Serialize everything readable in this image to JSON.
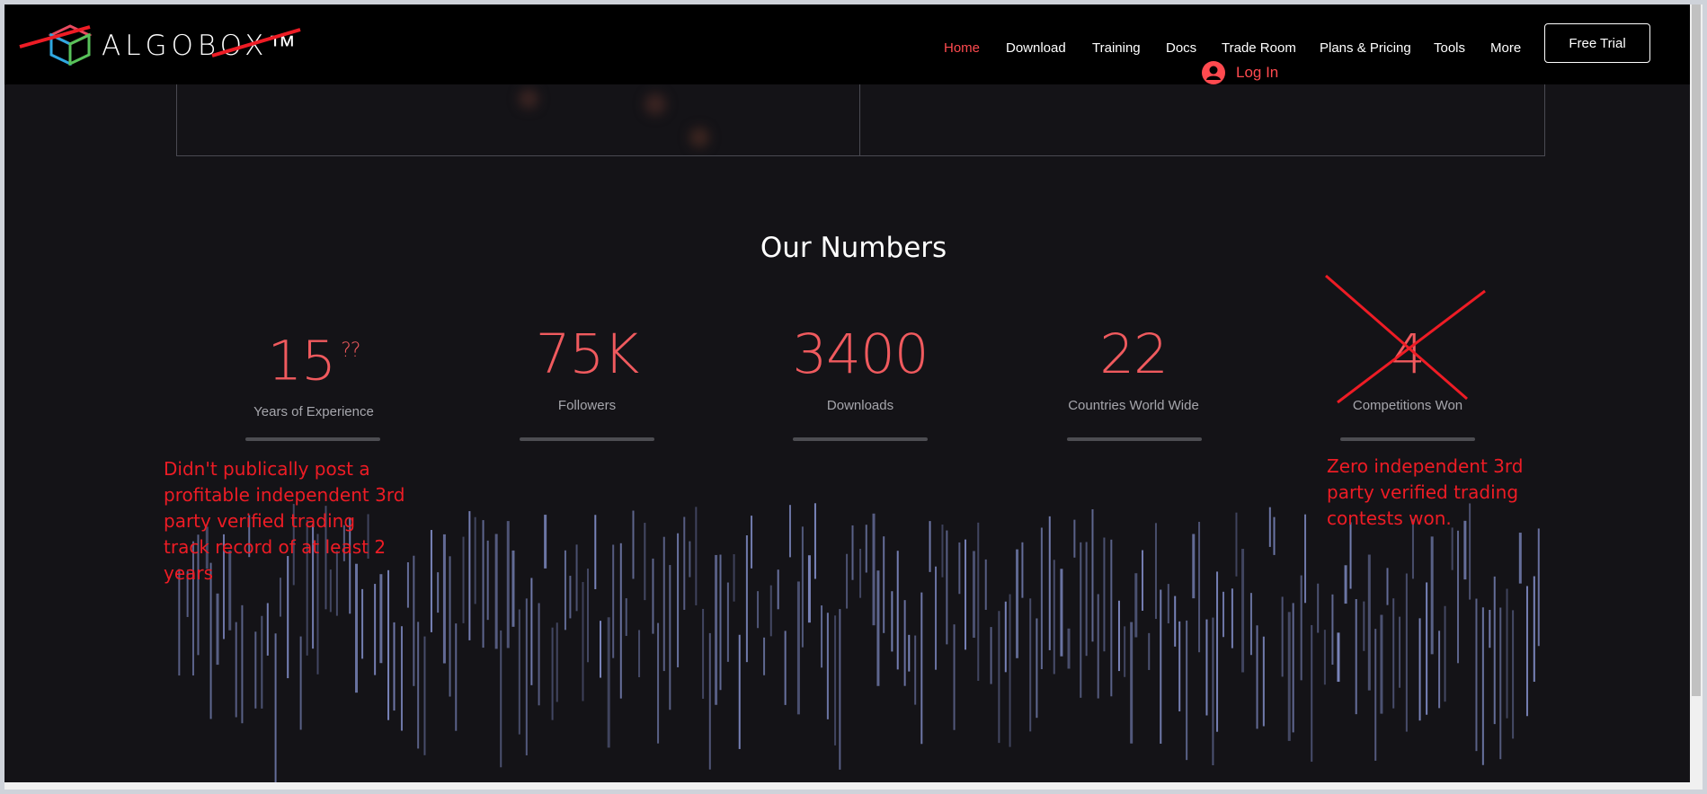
{
  "header": {
    "logo_text": "ALGOBOX™",
    "nav": [
      {
        "label": "Home",
        "active": true
      },
      {
        "label": "Download"
      },
      {
        "label": "Training"
      },
      {
        "label": "Docs"
      },
      {
        "label": "Trade Room"
      },
      {
        "label": "Plans & Pricing"
      },
      {
        "label": "Tools"
      },
      {
        "label": "More"
      }
    ],
    "cta_label": "Free Trial",
    "login_label": "Log In"
  },
  "section": {
    "title": "Our Numbers",
    "stats": [
      {
        "number": "15",
        "suffix": "??",
        "label": "Years of Experience"
      },
      {
        "number": "75K",
        "label": "Followers"
      },
      {
        "number": "3400",
        "label": "Downloads"
      },
      {
        "number": "22",
        "label": "Countries World Wide"
      },
      {
        "number": "4",
        "label": "Competitions Won"
      }
    ]
  },
  "annotations": {
    "left": "Didn't publically post a profitable independent 3rd party verified trading track record of at least 2 years",
    "right": "Zero independent 3rd party verified trading contests won."
  },
  "colors": {
    "accent": "#ff4a4f",
    "stat_number": "#f05a5e",
    "annotation": "#ee1c25",
    "background": "#141317",
    "header_bg": "#000000",
    "bars": "#8c99d8"
  }
}
